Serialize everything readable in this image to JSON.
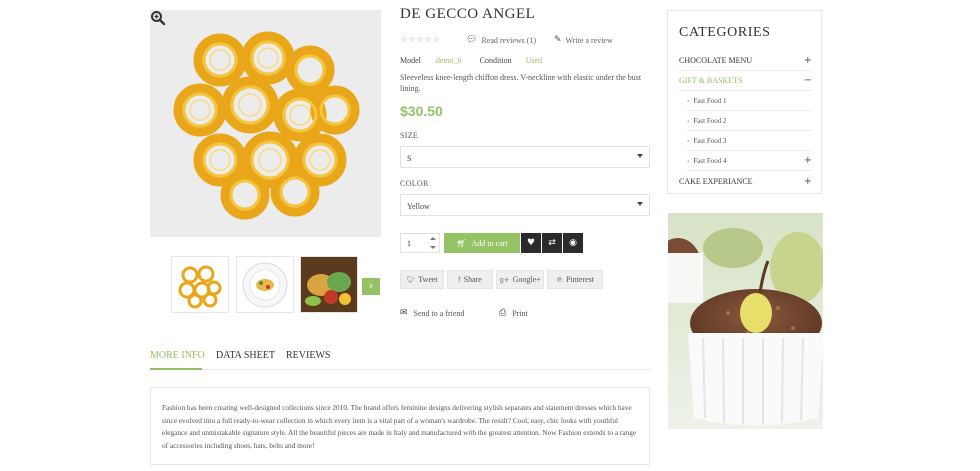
{
  "product": {
    "title": "DE GECCO ANGEL",
    "rating_stars": "☆☆☆☆☆",
    "read_reviews": "Read reviews (1)",
    "write_review": "Write a review",
    "model_label": "Model",
    "model_value": "demo_6",
    "condition_label": "Condition",
    "condition_value": "Used",
    "description": "Sleeveless knee-length chiffon dress. V-neckline with elastic under the bust lining.",
    "price": "$30.50",
    "size_label": "SIZE",
    "size_value": "S",
    "color_label": "COLOR",
    "color_value": "Yellow",
    "quantity": "1",
    "add_to_cart": "Add to cart"
  },
  "share": {
    "tweet": "Tweet",
    "share": "Share",
    "google": "Google+",
    "pinterest": "Pinterest"
  },
  "actions": {
    "send_friend": "Send to a friend",
    "print": "Print"
  },
  "tabs": [
    {
      "label": "MORE INFO"
    },
    {
      "label": "DATA SHEET"
    },
    {
      "label": "REVIEWS"
    }
  ],
  "tab_content": "Fashion has been creating well-designed collections since 2010. The brand offers feminine designs delivering stylish separates and statement dresses which have since evolved into a full ready-to-wear collection in which every item is a vital part of a woman's wardrobe. The result? Cool, easy, chic looks with youthful elegance and unmistakable signature style. All the beautiful pieces are made in Italy and manufactured with the greatest attention. Now Fashion extends to a range of accessories including shoes, hats, belts and more!",
  "categories": {
    "title": "CATEGORIES",
    "items": [
      {
        "label": "CHOCOLATE MENU",
        "toggle": "+"
      },
      {
        "label": "GIFT & BASKETS",
        "toggle": "−"
      },
      {
        "label": "CAKE EXPERIANCE",
        "toggle": "+"
      }
    ],
    "subitems": [
      {
        "label": "Fast Food 1",
        "toggle": ""
      },
      {
        "label": "Fast Food 2",
        "toggle": ""
      },
      {
        "label": "Fast Food 3",
        "toggle": ""
      },
      {
        "label": "Fast Food 4",
        "toggle": "+"
      }
    ]
  },
  "colors": {
    "accent": "#94c264",
    "dark_button": "#2b2b2b",
    "image_bg": "#ececec"
  },
  "icons": [
    "zoom-icon",
    "comment-icon",
    "pencil-icon",
    "cart-icon",
    "heart-icon",
    "compare-icon",
    "eye-icon",
    "twitter-icon",
    "facebook-icon",
    "google-plus-icon",
    "pinterest-icon",
    "envelope-icon",
    "print-icon",
    "chevron-right-icon"
  ]
}
